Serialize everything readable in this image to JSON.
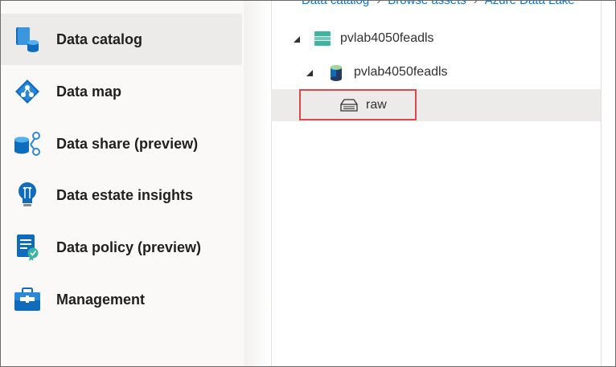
{
  "breadcrumb": {
    "items": [
      "Data catalog",
      "Browse assets",
      "Azure Data Lake"
    ],
    "separator": "›"
  },
  "sidebar": {
    "items": [
      {
        "label": "Data catalog",
        "icon": "data-catalog-icon",
        "selected": true
      },
      {
        "label": "Data map",
        "icon": "data-map-icon",
        "selected": false
      },
      {
        "label": "Data share (preview)",
        "icon": "data-share-icon",
        "selected": false
      },
      {
        "label": "Data estate insights",
        "icon": "insights-lightbulb-icon",
        "selected": false
      },
      {
        "label": "Data policy (preview)",
        "icon": "data-policy-icon",
        "selected": false
      },
      {
        "label": "Management",
        "icon": "management-toolbox-icon",
        "selected": false
      }
    ]
  },
  "tree": {
    "account": {
      "label": "pvlab4050feadls",
      "icon": "storage-account-icon",
      "expanded": true
    },
    "container": {
      "label": "pvlab4050feadls",
      "icon": "data-lake-container-icon",
      "expanded": true
    },
    "folder": {
      "label": "raw",
      "icon": "folder-storage-icon",
      "selected": true
    }
  },
  "colors": {
    "accent": "#0078d4",
    "selection": "#edebe9",
    "highlight_border": "#e0474c",
    "teal": "#3bb4a0"
  }
}
